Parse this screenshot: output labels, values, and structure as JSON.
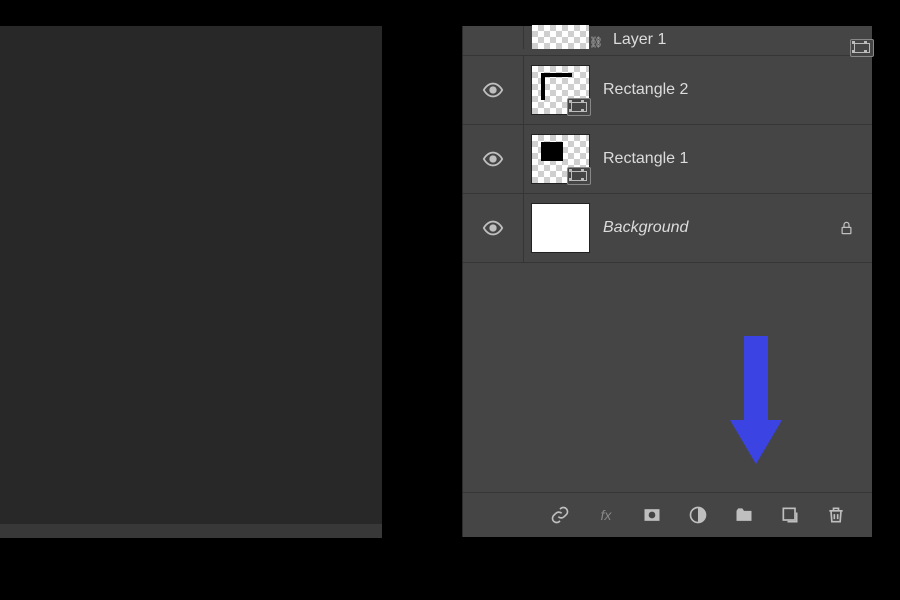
{
  "layers": {
    "layer_top": "Layer 1",
    "rect2": "Rectangle 2",
    "rect1": "Rectangle 1",
    "background": "Background"
  },
  "footer": {
    "fx": "fx"
  },
  "icons": {
    "eye": "eye-icon",
    "lock": "lock-icon",
    "link": "link-icon",
    "fx": "fx-icon",
    "mask": "mask-icon",
    "adjustment": "adjustment-icon",
    "group": "folder-icon",
    "newlayer": "new-layer-icon",
    "trash": "trash-icon"
  },
  "annotation": {
    "arrow_color": "#3b44e3"
  }
}
